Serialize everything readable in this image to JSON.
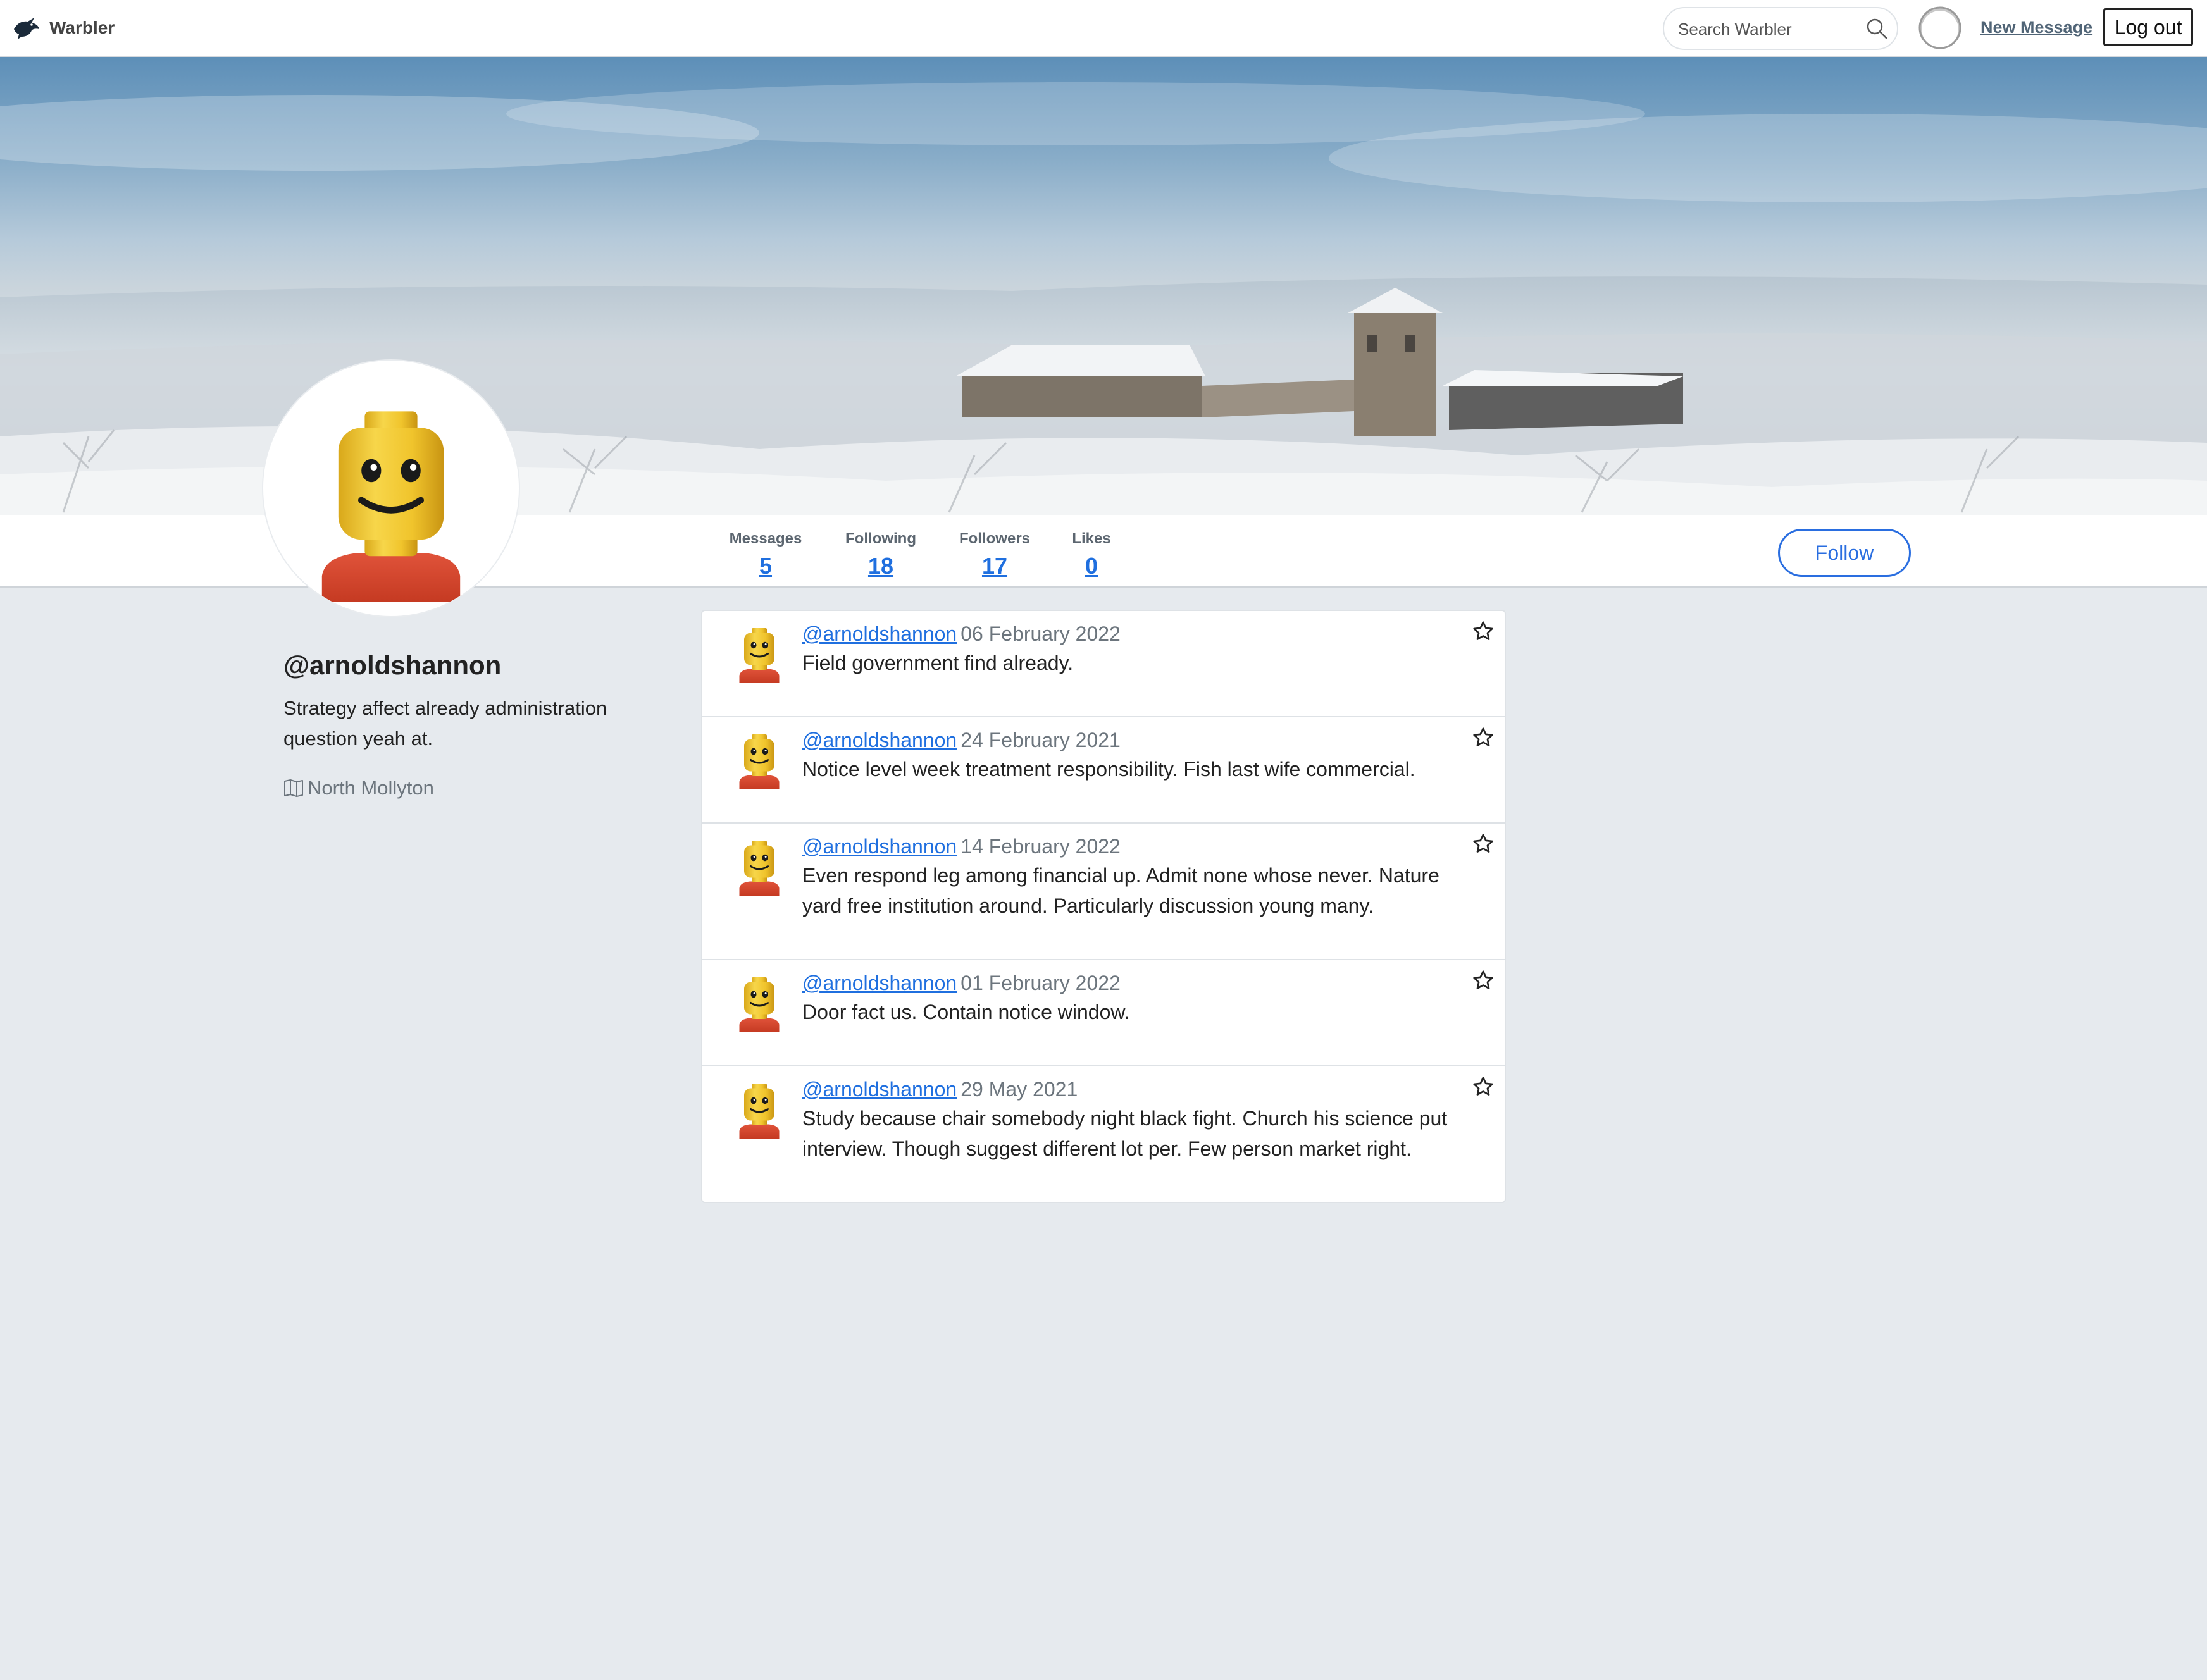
{
  "nav": {
    "brand": "Warbler",
    "search_placeholder": "Search Warbler",
    "new_message": "New Message",
    "logout": "Log out",
    "icons": {
      "logo": "bird-logo-icon",
      "search": "search-icon",
      "avatar": "user-avatar-icon"
    }
  },
  "stats": [
    {
      "label": "Messages",
      "value": "5"
    },
    {
      "label": "Following",
      "value": "18"
    },
    {
      "label": "Followers",
      "value": "17"
    },
    {
      "label": "Likes",
      "value": "0"
    }
  ],
  "follow_label": "Follow",
  "profile": {
    "username": "@arnoldshannon",
    "bio": "Strategy affect already administration question yeah at.",
    "location": "North Mollyton",
    "location_icon": "map-icon"
  },
  "messages": [
    {
      "user": "@arnoldshannon",
      "date": "06 February 2022",
      "text": "Field government find already."
    },
    {
      "user": "@arnoldshannon",
      "date": "24 February 2021",
      "text": "Notice level week treatment responsibility. Fish last wife commercial."
    },
    {
      "user": "@arnoldshannon",
      "date": "14 February 2022",
      "text": "Even respond leg among financial up. Admit none whose never. Nature yard free institution around. Particularly discussion young many."
    },
    {
      "user": "@arnoldshannon",
      "date": "01 February 2022",
      "text": "Door fact us. Contain notice window."
    },
    {
      "user": "@arnoldshannon",
      "date": "29 May 2021",
      "text": "Study because chair somebody night black fight. Church his science put interview. Though suggest different lot per. Few person market right."
    }
  ],
  "colors": {
    "link": "#1f6fdf",
    "page_bg": "#e6eaee",
    "lego_yellow": "#f2c52c",
    "lego_red": "#d9442a"
  }
}
